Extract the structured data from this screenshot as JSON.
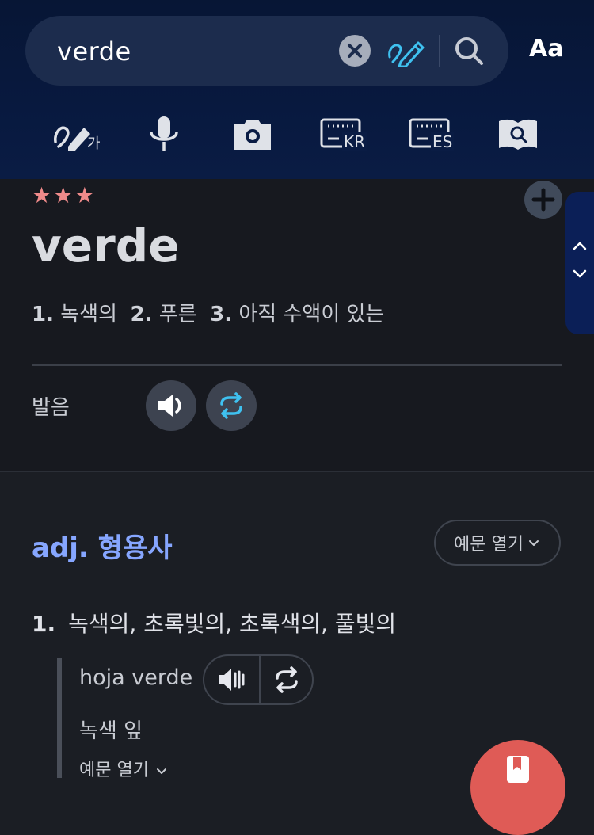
{
  "search": {
    "query": "verde"
  },
  "header": {
    "font_button": "Aa"
  },
  "tools": [
    {
      "name": "handwriting-korean",
      "label": "가"
    },
    {
      "name": "voice"
    },
    {
      "name": "camera"
    },
    {
      "name": "keyboard-kr",
      "label": "KR"
    },
    {
      "name": "keyboard-es",
      "label": "ES"
    },
    {
      "name": "dictionary"
    }
  ],
  "entry": {
    "stars": "★★★",
    "headword": "verde",
    "summary": [
      {
        "num": "1.",
        "text": "녹색의"
      },
      {
        "num": "2.",
        "text": "푸른"
      },
      {
        "num": "3.",
        "text": "아직 수액이 있는"
      }
    ],
    "pronunciation_label": "발음"
  },
  "sense": {
    "pos": "adj. 형용사",
    "examples_button": "예문 열기",
    "definition_num": "1.",
    "definition": "녹색의, 초록빛의, 초록색의, 풀빛의",
    "example_text": "hoja verde",
    "example_translation": "녹색 잎",
    "example_more": "예문 열기"
  },
  "colors": {
    "accent_blue": "#86a6ff",
    "star": "#ef8a8a",
    "fab": "#df5b56",
    "handwrite_icon": "#3fc1f0"
  }
}
